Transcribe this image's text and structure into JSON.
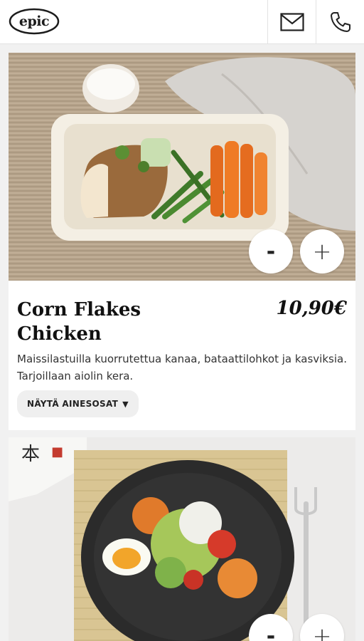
{
  "header": {
    "logo_text": "epic",
    "mail_icon": "mail-icon",
    "phone_icon": "phone-icon"
  },
  "products": [
    {
      "title": "Corn Flakes Chicken",
      "price": "10,90€",
      "description": "Maissilastuilla kuorrutettua kanaa, bataattilohkot ja kasviksia. Tarjoillaan aiolin kera.",
      "ingredients_label": "NÄYTÄ AINESOSAT",
      "minus_label": "-",
      "plus_label": "+"
    },
    {
      "minus_label": "-",
      "plus_label": "+"
    }
  ],
  "colors": {
    "background": "#f1f1f1",
    "card": "#ffffff",
    "text": "#111111",
    "button_bg": "#efefef"
  }
}
